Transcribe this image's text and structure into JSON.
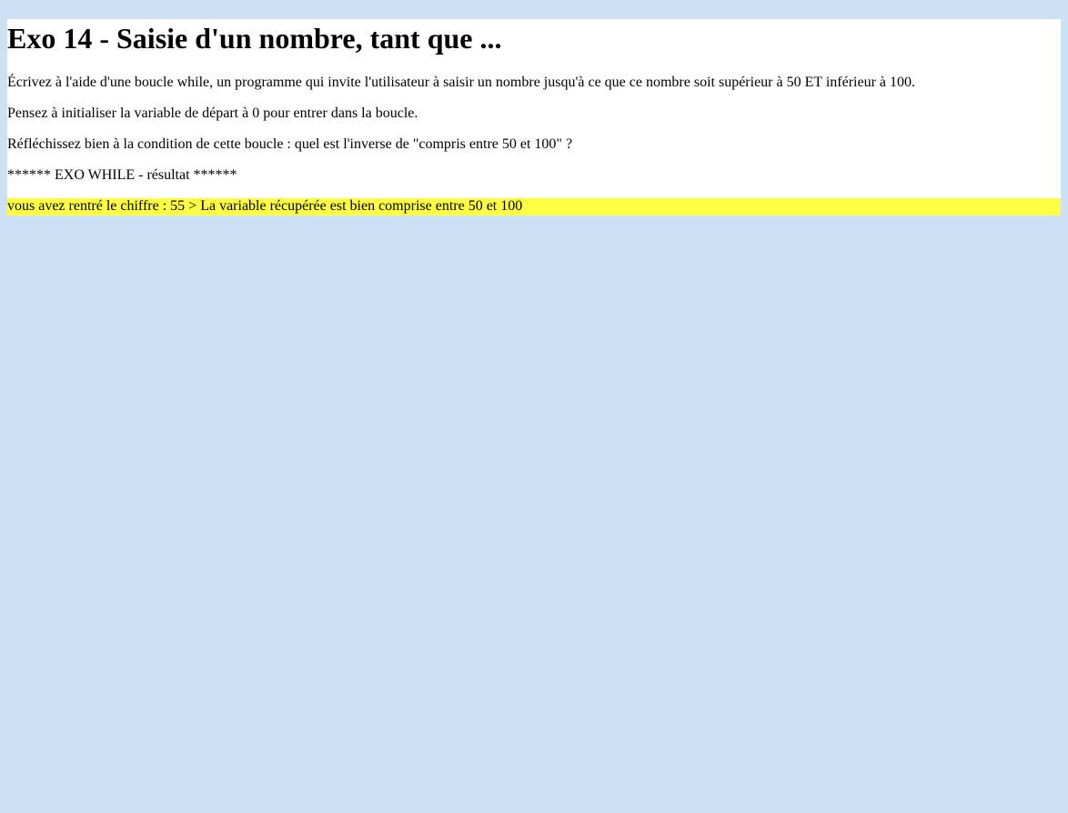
{
  "page": {
    "title": "Exo 14 - Saisie d'un nombre, tant que ...",
    "instructions": [
      "Écrivez à l'aide d'une boucle while, un programme qui invite l'utilisateur à saisir un nombre jusqu'à ce que ce nombre soit supérieur à 50 ET inférieur à 100.",
      "Pensez à initialiser la variable de départ à 0 pour entrer dans la boucle.",
      "Réfléchissez bien à la condition de cette boucle : quel est l'inverse de \"compris entre 50 et 100\" ?"
    ],
    "result_header": "****** EXO WHILE - résultat ******",
    "result_line": "vous avez rentré le chiffre : 55 > La variable récupérée est bien comprise entre 50 et 100"
  },
  "colors": {
    "page_background": "#cce1f6",
    "content_background": "#ffffff",
    "highlight": "#ffff44"
  }
}
